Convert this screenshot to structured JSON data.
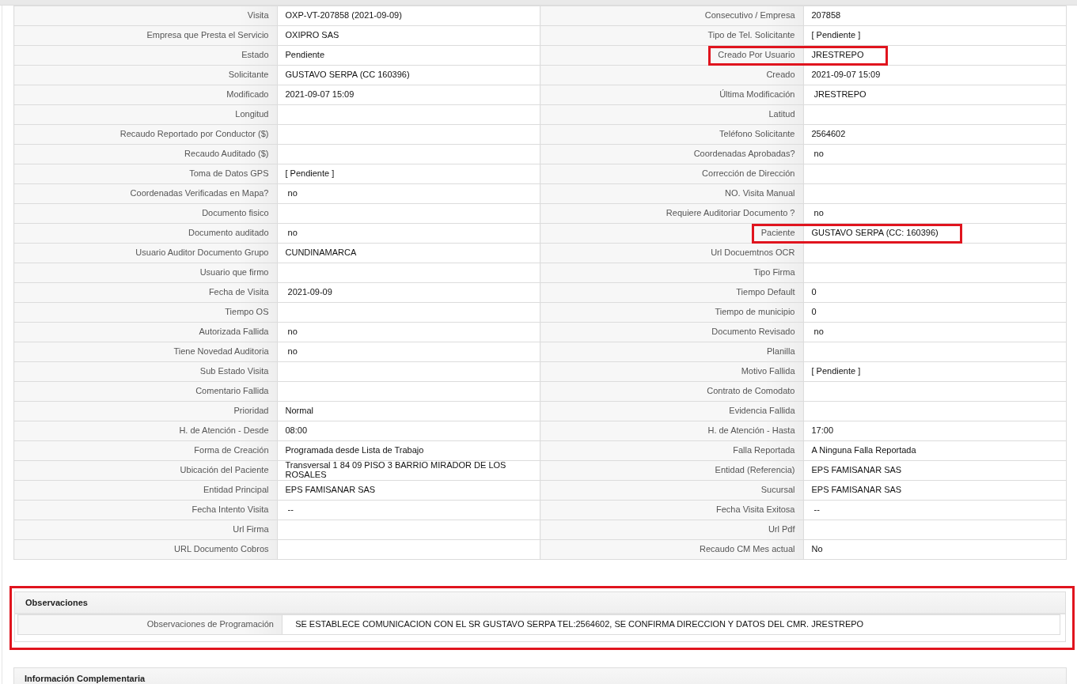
{
  "details": {
    "rows": [
      {
        "left": {
          "label": "Visita",
          "value": "OXP-VT-207858 (2021-09-09)",
          "highlighted": false
        },
        "right": {
          "label": "Consecutivo / Empresa",
          "value": "207858",
          "highlighted": false
        }
      },
      {
        "left": {
          "label": "Empresa que Presta el Servicio",
          "value": "OXIPRO SAS",
          "highlighted": false
        },
        "right": {
          "label": "Tipo de Tel. Solicitante",
          "value": "[ Pendiente ]",
          "highlighted": false
        }
      },
      {
        "left": {
          "label": "Estado",
          "value": "Pendiente",
          "highlighted": false
        },
        "right": {
          "label": "Creado Por Usuario",
          "value": "JRESTREPO",
          "highlighted": true
        }
      },
      {
        "left": {
          "label": "Solicitante",
          "value": "GUSTAVO SERPA (CC 160396)",
          "highlighted": false
        },
        "right": {
          "label": "Creado",
          "value": "2021-09-07 15:09",
          "highlighted": false
        }
      },
      {
        "left": {
          "label": "Modificado",
          "value": "2021-09-07 15:09",
          "highlighted": false
        },
        "right": {
          "label": "Última Modificación",
          "value": " JRESTREPO",
          "highlighted": false
        }
      },
      {
        "left": {
          "label": "Longitud",
          "highlighted": false
        },
        "right": {
          "label": "Latitud",
          "highlighted": false
        }
      },
      {
        "left": {
          "label": "Recaudo Reportado por Conductor ($)",
          "highlighted": false
        },
        "right": {
          "label": "Teléfono Solicitante",
          "value": "2564602",
          "highlighted": false
        }
      },
      {
        "left": {
          "label": "Recaudo Auditado ($)",
          "highlighted": false
        },
        "right": {
          "label": "Coordenadas Aprobadas?",
          "value": " no",
          "highlighted": false
        }
      },
      {
        "left": {
          "label": "Toma de Datos GPS",
          "value": "[ Pendiente ]",
          "highlighted": false
        },
        "right": {
          "label": "Corrección de Dirección",
          "highlighted": false
        }
      },
      {
        "left": {
          "label": "Coordenadas Verificadas en Mapa?",
          "value": " no",
          "highlighted": false
        },
        "right": {
          "label": "NO. Visita Manual",
          "highlighted": false
        }
      },
      {
        "left": {
          "label": "Documento fisico",
          "highlighted": false
        },
        "right": {
          "label": "Requiere Auditoriar Documento ?",
          "value": " no",
          "highlighted": false
        }
      },
      {
        "left": {
          "label": "Documento auditado",
          "value": " no",
          "highlighted": false
        },
        "right": {
          "label": "Paciente",
          "value": "GUSTAVO SERPA (CC: 160396)",
          "highlighted": true
        }
      },
      {
        "left": {
          "label": "Usuario Auditor Documento Grupo",
          "value": "CUNDINAMARCA",
          "highlighted": false
        },
        "right": {
          "label": "Url Docuemtnos OCR",
          "highlighted": false
        }
      },
      {
        "left": {
          "label": "Usuario que firmo",
          "highlighted": false
        },
        "right": {
          "label": "Tipo Firma",
          "highlighted": false
        }
      },
      {
        "left": {
          "label": "Fecha de Visita",
          "value": " 2021-09-09",
          "highlighted": false
        },
        "right": {
          "label": "Tiempo Default",
          "value": "0",
          "highlighted": false
        }
      },
      {
        "left": {
          "label": "Tiempo OS",
          "highlighted": false
        },
        "right": {
          "label": "Tiempo de municipio",
          "value": "0",
          "highlighted": false
        }
      },
      {
        "left": {
          "label": "Autorizada Fallida",
          "value": " no",
          "highlighted": false
        },
        "right": {
          "label": "Documento Revisado",
          "value": " no",
          "highlighted": false
        }
      },
      {
        "left": {
          "label": "Tiene Novedad Auditoria",
          "value": " no",
          "highlighted": false
        },
        "right": {
          "label": "Planilla",
          "highlighted": false
        }
      },
      {
        "left": {
          "label": "Sub Estado Visita",
          "highlighted": false
        },
        "right": {
          "label": "Motivo Fallida",
          "value": "[ Pendiente ]",
          "highlighted": false
        }
      },
      {
        "left": {
          "label": "Comentario Fallida",
          "highlighted": false
        },
        "right": {
          "label": "Contrato de Comodato",
          "highlighted": false
        }
      },
      {
        "left": {
          "label": "Prioridad",
          "value": "Normal",
          "highlighted": false
        },
        "right": {
          "label": "Evidencia Fallida",
          "highlighted": false
        }
      },
      {
        "left": {
          "label": "H. de Atención - Desde",
          "value": "08:00",
          "highlighted": false
        },
        "right": {
          "label": "H. de Atención - Hasta",
          "value": "17:00",
          "highlighted": false
        }
      },
      {
        "left": {
          "label": "Forma de Creación",
          "value": "Programada desde Lista de Trabajo",
          "highlighted": false
        },
        "right": {
          "label": "Falla Reportada",
          "value": "A Ninguna Falla Reportada",
          "highlighted": false
        }
      },
      {
        "left": {
          "label": "Ubicación del Paciente",
          "value": "Transversal 1 84 09 PISO 3 BARRIO MIRADOR DE LOS ROSALES",
          "highlighted": false
        },
        "right": {
          "label": "Entidad (Referencia)",
          "value": "EPS FAMISANAR SAS",
          "highlighted": false
        }
      },
      {
        "left": {
          "label": "Entidad Principal",
          "value": "EPS FAMISANAR SAS",
          "highlighted": false
        },
        "right": {
          "label": "Sucursal",
          "value": "EPS FAMISANAR SAS",
          "highlighted": false
        }
      },
      {
        "left": {
          "label": "Fecha Intento Visita",
          "value": " --",
          "highlighted": false
        },
        "right": {
          "label": "Fecha Visita Exitosa",
          "value": " --",
          "highlighted": false
        }
      },
      {
        "left": {
          "label": "Url Firma",
          "highlighted": false
        },
        "right": {
          "label": "Url Pdf",
          "highlighted": false
        }
      },
      {
        "left": {
          "label": "URL Documento Cobros",
          "highlighted": false
        },
        "right": {
          "label": "Recaudo CM Mes actual",
          "value": "No",
          "highlighted": false
        }
      }
    ]
  },
  "observaciones": {
    "title": "Observaciones",
    "highlighted": true,
    "rows": [
      {
        "label": "Observaciones de Programación",
        "value": "  SE ESTABLECE COMUNICACION CON EL SR GUSTAVO SERPA TEL:2564602, SE CONFIRMA DIRECCION Y DATOS DEL CMR. JRESTREPO"
      }
    ]
  },
  "informacion_complementaria": {
    "title": "Información Complementaria"
  }
}
